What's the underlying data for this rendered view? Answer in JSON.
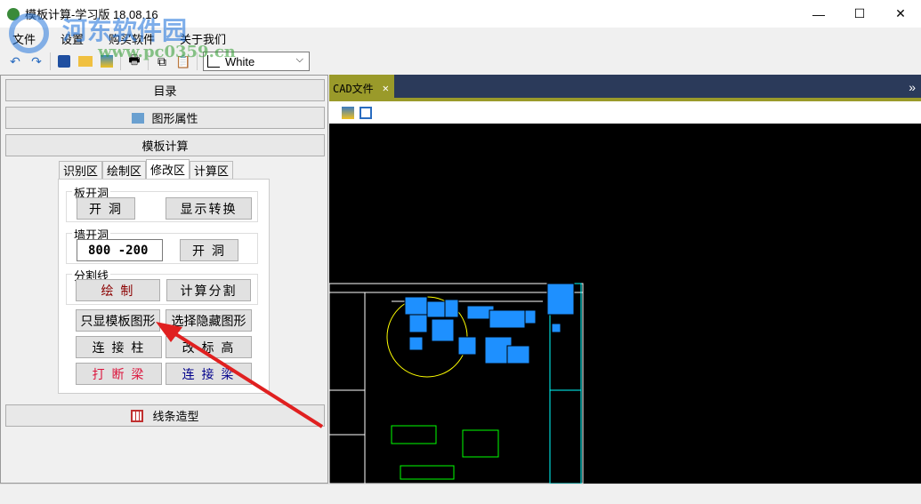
{
  "window": {
    "title": "模板计算-学习版 18.08.16",
    "minimize": "—",
    "maximize": "☐",
    "close": "✕"
  },
  "menu": [
    "文件",
    "设置",
    "购买软件",
    "关于我们"
  ],
  "toolbar": {
    "color_select": "White",
    "chevron": "⌵"
  },
  "left": {
    "bars": {
      "catalog": "目录",
      "shape_props": "图形属性",
      "template_calc": "模板计算",
      "line_model": "线条造型"
    },
    "tabs": [
      "识别区",
      "绘制区",
      "修改区",
      "计算区"
    ],
    "active_tab": "修改区",
    "groups": {
      "slab": {
        "label": "板开洞",
        "open": "开 洞",
        "toggle": "显示转换"
      },
      "wall": {
        "label": "墙开洞",
        "input": "800 -200",
        "open": "开 洞"
      },
      "split": {
        "label": "分割线",
        "draw": "绘 制",
        "calc": "计算分割"
      }
    },
    "buttons": {
      "show_template": "只显模板图形",
      "select_hidden": "选择隐藏图形",
      "connect_col": "连 接 柱",
      "change_elev": "改 标 高",
      "break_beam": "打 断 梁",
      "connect_beam": "连 接 梁"
    },
    "colors": {
      "draw": "#8b0000",
      "break_beam": "#dc143c",
      "connect_beam": "#00008b"
    }
  },
  "cad": {
    "tab": "CAD文件",
    "close": "✕",
    "expand": "»"
  },
  "watermark": {
    "name": "河东软件园",
    "url": "www.pc0359.cn"
  }
}
